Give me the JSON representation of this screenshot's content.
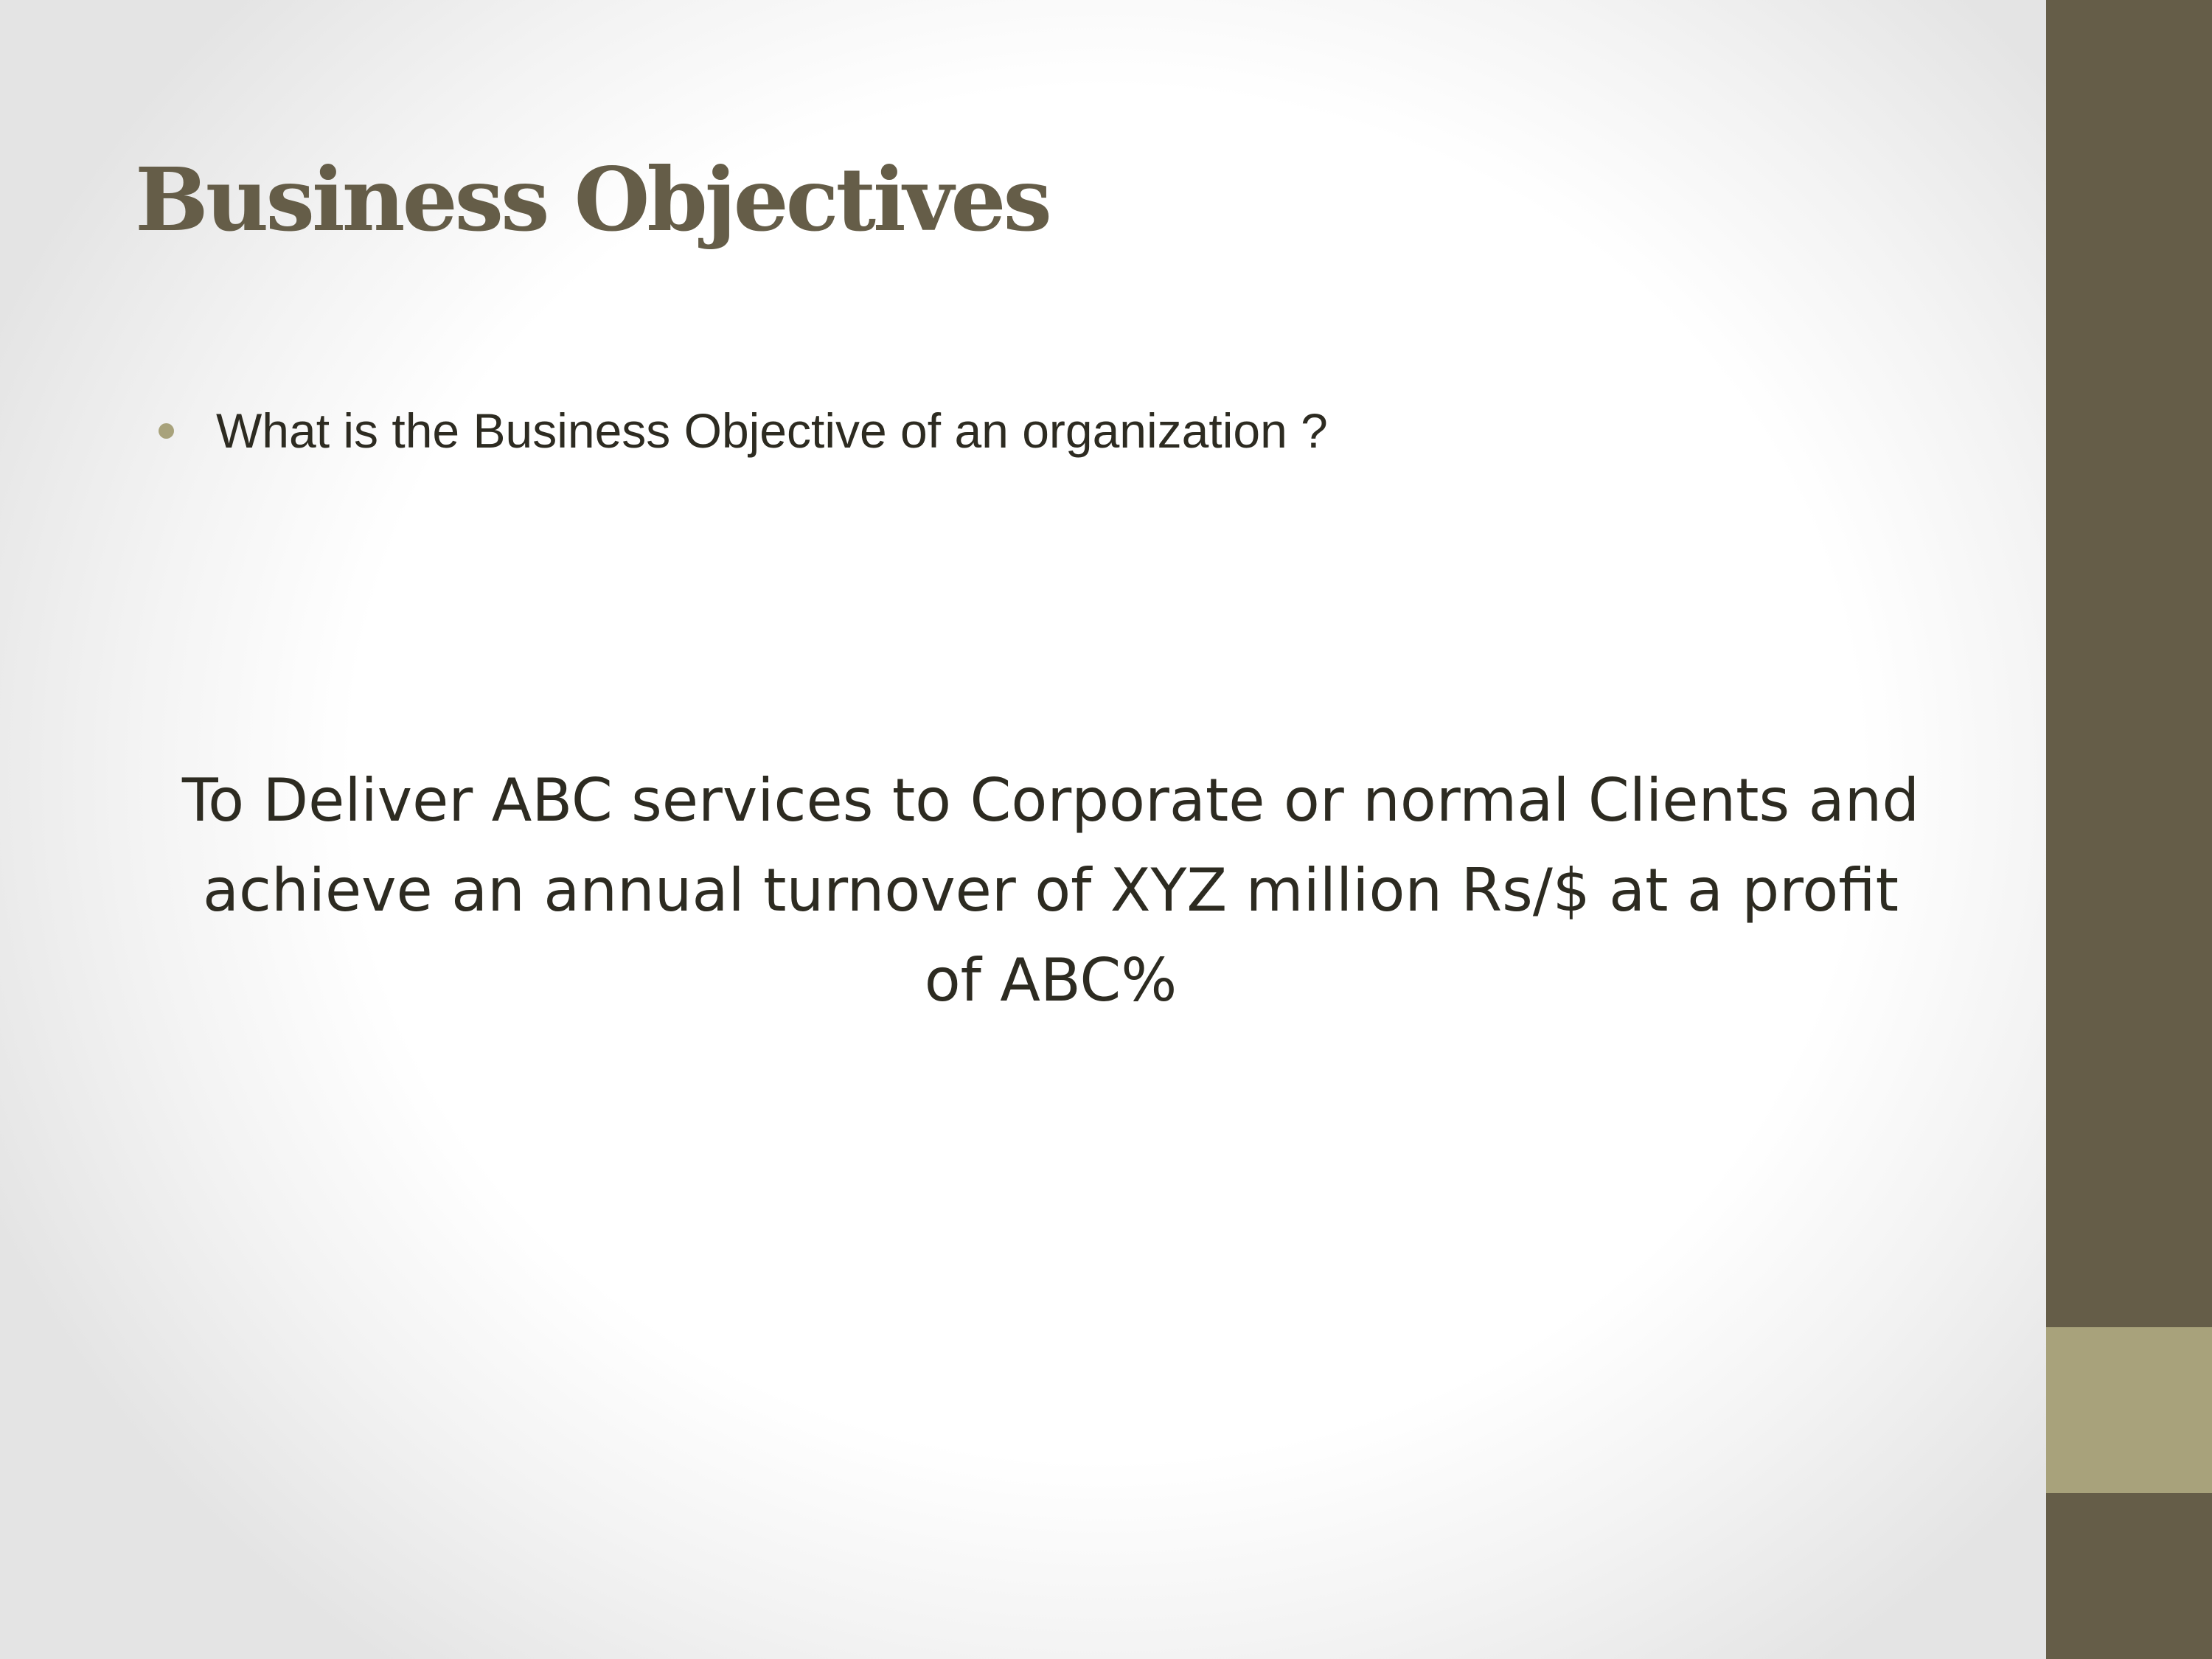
{
  "slide": {
    "title": "Business Objectives",
    "bullets": [
      "What is the Business Objective of an organization ?"
    ],
    "statement_lines": [
      "To Deliver ABC services to Corporate or  normal Clients and",
      "achieve an annual turnover of XYZ million Rs/$ at a profit",
      "of ABC%"
    ]
  },
  "theme": {
    "title_color": "#655d48",
    "sidebar_color": "#655d48",
    "accent_color": "#a8a27b",
    "text_color": "#2d2b21"
  }
}
